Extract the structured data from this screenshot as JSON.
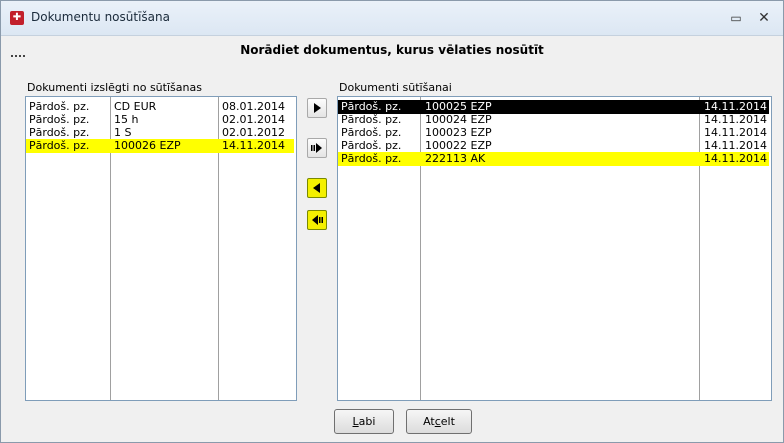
{
  "window": {
    "title": "Dokumentu nosūtīšana"
  },
  "heading": "Norādiet dokumentus, kurus vēlaties nosūtīt",
  "left_panel": {
    "label": "Dokumenti izslēgti no sūtīšanas",
    "rows": [
      {
        "type": "Pārdoš. pz.",
        "number": "CD EUR",
        "date": "08.01.2014",
        "state": "normal"
      },
      {
        "type": "Pārdoš. pz.",
        "number": "15 h",
        "date": "02.01.2014",
        "state": "normal"
      },
      {
        "type": "Pārdoš. pz.",
        "number": "1 S",
        "date": "02.01.2012",
        "state": "normal"
      },
      {
        "type": "Pārdoš. pz.",
        "number": "100026 EZP",
        "date": "14.11.2014",
        "state": "highlight"
      }
    ]
  },
  "right_panel": {
    "label": "Dokumenti sūtīšanai",
    "rows": [
      {
        "type": "Pārdoš. pz.",
        "number": "100025 EZP",
        "date": "14.11.2014",
        "state": "selected"
      },
      {
        "type": "Pārdoš. pz.",
        "number": "100024 EZP",
        "date": "14.11.2014",
        "state": "normal"
      },
      {
        "type": "Pārdoš. pz.",
        "number": "100023 EZP",
        "date": "14.11.2014",
        "state": "normal"
      },
      {
        "type": "Pārdoš. pz.",
        "number": "100022 EZP",
        "date": "14.11.2014",
        "state": "normal"
      },
      {
        "type": "Pārdoš. pz.",
        "number": "222113 AK",
        "date": "14.11.2014",
        "state": "highlight"
      }
    ]
  },
  "transfer_buttons": [
    {
      "name": "move-right-icon",
      "active": false
    },
    {
      "name": "move-all-right-icon",
      "active": false
    },
    {
      "name": "move-left-icon",
      "active": true
    },
    {
      "name": "move-all-left-icon",
      "active": true
    }
  ],
  "buttons": {
    "ok_hotkey": "L",
    "ok_rest": "abi",
    "cancel_pre": "At",
    "cancel_hotkey": "c",
    "cancel_rest": "elt"
  },
  "colors": {
    "highlight": "#ffff00",
    "selected_bg": "#000000",
    "app_icon": "#c2202b"
  }
}
